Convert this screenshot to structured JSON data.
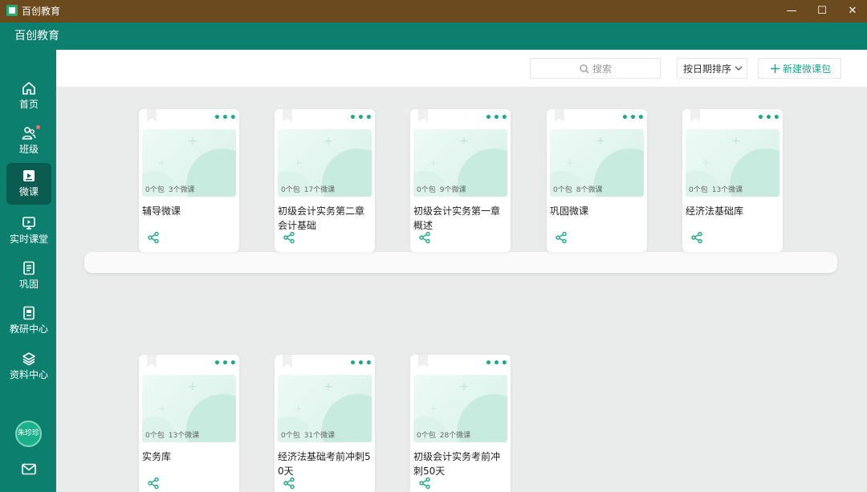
{
  "window": {
    "title": "百创教育",
    "minimize": "—",
    "maximize": "☐",
    "close": "✕"
  },
  "app": {
    "name": "百创教育"
  },
  "sidebar": {
    "items": [
      {
        "label": "首页",
        "icon": "home-icon"
      },
      {
        "label": "班级",
        "icon": "users-icon",
        "badge": true
      },
      {
        "label": "微课",
        "icon": "microclass-icon",
        "active": true
      },
      {
        "label": "实时课堂",
        "icon": "live-class-icon"
      },
      {
        "label": "巩固",
        "icon": "notebook-icon"
      },
      {
        "label": "教研中心",
        "icon": "research-icon"
      },
      {
        "label": "资料中心",
        "icon": "layers-icon"
      }
    ],
    "user": {
      "name": "朱珍珍"
    },
    "mail_icon": "mail-icon"
  },
  "toolbar": {
    "search_placeholder": "搜索",
    "sort_label": "按日期排序",
    "new_label": "新建微课包"
  },
  "cards": [
    {
      "packages": "0个包",
      "lessons": "3个微课",
      "name": "辅导微课"
    },
    {
      "packages": "0个包",
      "lessons": "17个微课",
      "name": "初级会计实务第二章会计基础"
    },
    {
      "packages": "0个包",
      "lessons": "9个微课",
      "name": "初级会计实务第一章概述"
    },
    {
      "packages": "0个包",
      "lessons": "8个微课",
      "name": "巩固微课"
    },
    {
      "packages": "0个包",
      "lessons": "13个微课",
      "name": "经济法基础库"
    },
    {
      "packages": "0个包",
      "lessons": "13个微课",
      "name": "实务库"
    },
    {
      "packages": "0个包",
      "lessons": "31个微课",
      "name": "经济法基础考前冲刺50天"
    },
    {
      "packages": "0个包",
      "lessons": "28个微课",
      "name": "初级会计实务考前冲刺50天"
    }
  ],
  "colors": {
    "primary": "#0d7f6e",
    "accent": "#1aa98a",
    "titlebar": "#6b4a1e",
    "background": "#e9eceb"
  }
}
